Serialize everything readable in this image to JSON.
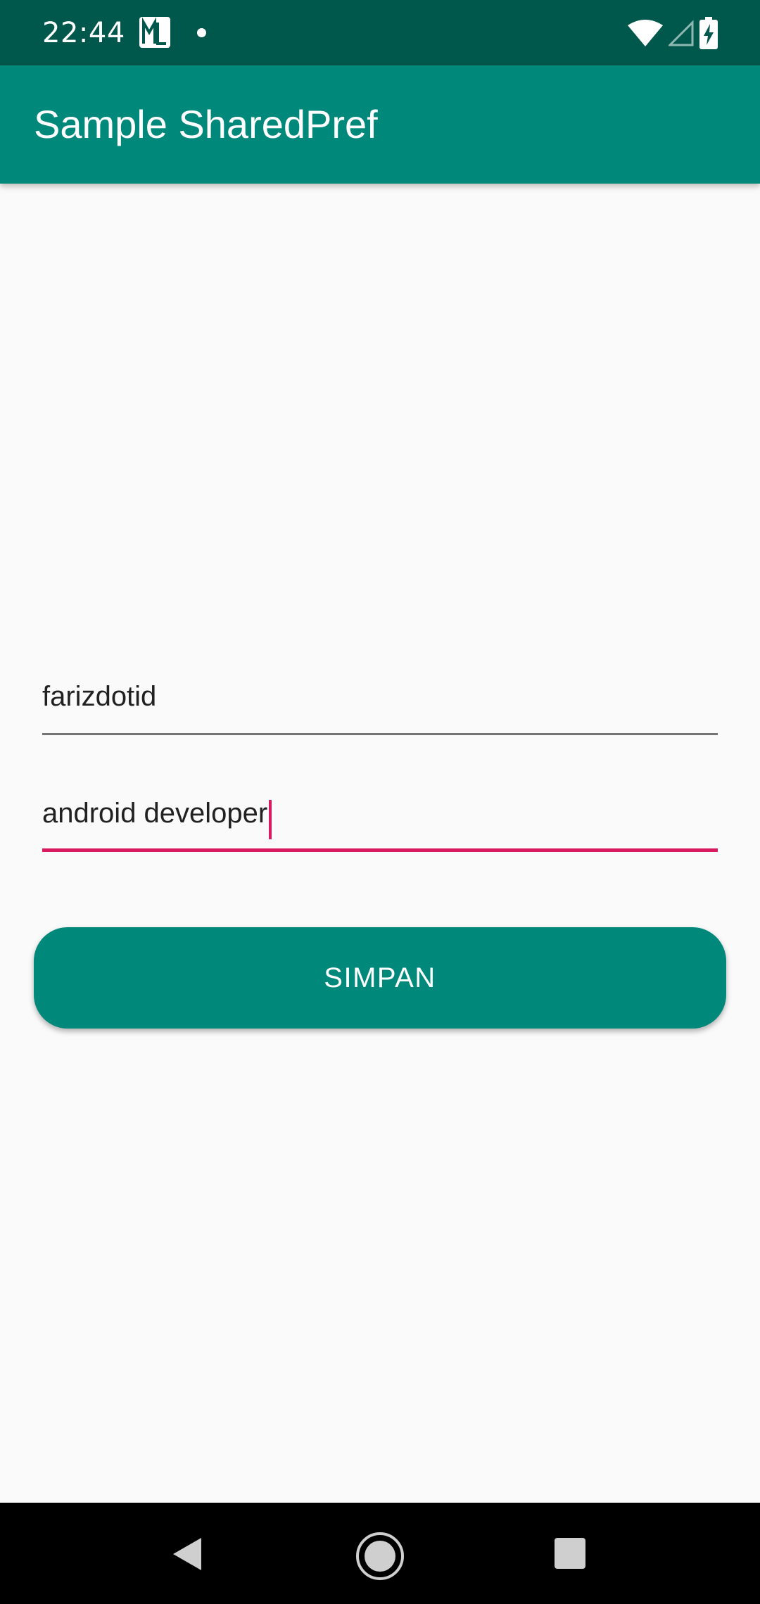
{
  "status_bar": {
    "time": "22:44",
    "icons": [
      "app-notification-icon",
      "notification-dot-icon",
      "wifi-icon",
      "cell-signal-icon",
      "battery-charging-icon"
    ]
  },
  "app_bar": {
    "title": "Sample SharedPref"
  },
  "form": {
    "name_field": {
      "value": "farizdotid"
    },
    "job_field": {
      "value": "android developer"
    },
    "save_label": "SIMPAN"
  },
  "nav_bar": {
    "icons": [
      "back-icon",
      "home-icon",
      "recents-icon"
    ]
  },
  "colors": {
    "status_bar": "#00574b",
    "primary": "#00897b",
    "accent": "#d81b60",
    "background": "#fafafa"
  }
}
